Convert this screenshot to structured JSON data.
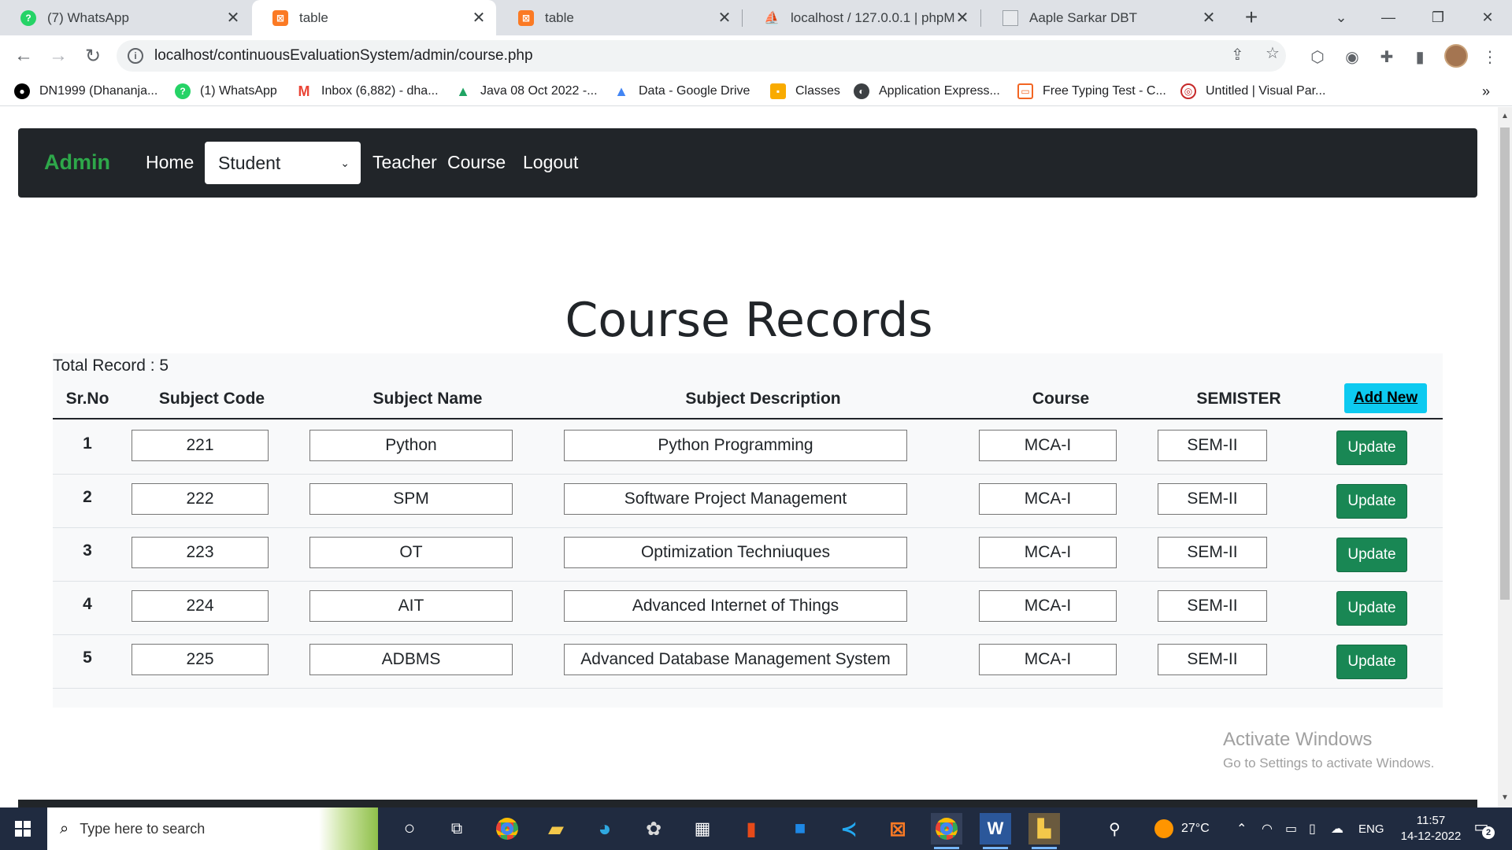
{
  "browser": {
    "tabs": [
      {
        "title": "(7) WhatsApp",
        "icon": "whatsapp-icon",
        "active": false
      },
      {
        "title": "table",
        "icon": "xampp-icon",
        "active": true
      },
      {
        "title": "table",
        "icon": "xampp-icon",
        "active": false
      },
      {
        "title": "localhost / 127.0.0.1 | phpMyA",
        "icon": "phpmyadmin-icon",
        "active": false
      },
      {
        "title": "Aaple Sarkar DBT",
        "icon": "document-icon",
        "active": false
      }
    ],
    "url": "localhost/continuousEvaluationSystem/admin/course.php",
    "bookmarks": [
      {
        "label": "DN1999 (Dhananja...",
        "icon": "github-icon"
      },
      {
        "label": "(1) WhatsApp",
        "icon": "whatsapp-icon"
      },
      {
        "label": "Inbox (6,882) - dha...",
        "icon": "gmail-icon"
      },
      {
        "label": "Java 08 Oct 2022 -...",
        "icon": "google-drive-icon"
      },
      {
        "label": "Data - Google Drive",
        "icon": "google-drive-icon"
      },
      {
        "label": "Classes",
        "icon": "classroom-icon"
      },
      {
        "label": "Application Express...",
        "icon": "globe-icon"
      },
      {
        "label": "Free Typing Test - C...",
        "icon": "typing-test-icon"
      },
      {
        "label": "Untitled | Visual Par...",
        "icon": "visual-paradigm-icon"
      }
    ],
    "bookmarks_overflow": "»"
  },
  "navbar": {
    "brand": "Admin",
    "home": "Home",
    "dropdown_selected": "Student",
    "teacher": "Teacher",
    "course": "Course",
    "logout": "Logout"
  },
  "page": {
    "title": "Course Records",
    "total_record": "Total Record : 5",
    "add_new": "Add New",
    "update_label": "Update"
  },
  "table": {
    "headers": {
      "srno": "Sr.No",
      "code": "Subject Code",
      "name": "Subject Name",
      "desc": "Subject Description",
      "course": "Course",
      "sem": "SEMISTER"
    },
    "rows": [
      {
        "sr": "1",
        "code": "221",
        "name": "Python",
        "desc": "Python Programming",
        "course": "MCA-I",
        "sem": "SEM-II"
      },
      {
        "sr": "2",
        "code": "222",
        "name": "SPM",
        "desc": "Software Project Management",
        "course": "MCA-I",
        "sem": "SEM-II"
      },
      {
        "sr": "3",
        "code": "223",
        "name": "OT",
        "desc": "Optimization Techniuques",
        "course": "MCA-I",
        "sem": "SEM-II"
      },
      {
        "sr": "4",
        "code": "224",
        "name": "AIT",
        "desc": "Advanced Internet of Things",
        "course": "MCA-I",
        "sem": "SEM-II"
      },
      {
        "sr": "5",
        "code": "225",
        "name": "ADBMS",
        "desc": "Advanced Database Management System",
        "course": "MCA-I",
        "sem": "SEM-II"
      }
    ]
  },
  "watermark": {
    "line1": "Activate Windows",
    "line2": "Go to Settings to activate Windows."
  },
  "taskbar": {
    "search_placeholder": "Type here to search",
    "temperature": "27°C",
    "language": "ENG",
    "time": "11:57",
    "date": "14-12-2022",
    "notification_count": "2"
  },
  "colors": {
    "brand_green": "#2ea84a",
    "navbar_bg": "#212529",
    "update_button": "#198754",
    "add_new_button": "#0dcaf0"
  }
}
